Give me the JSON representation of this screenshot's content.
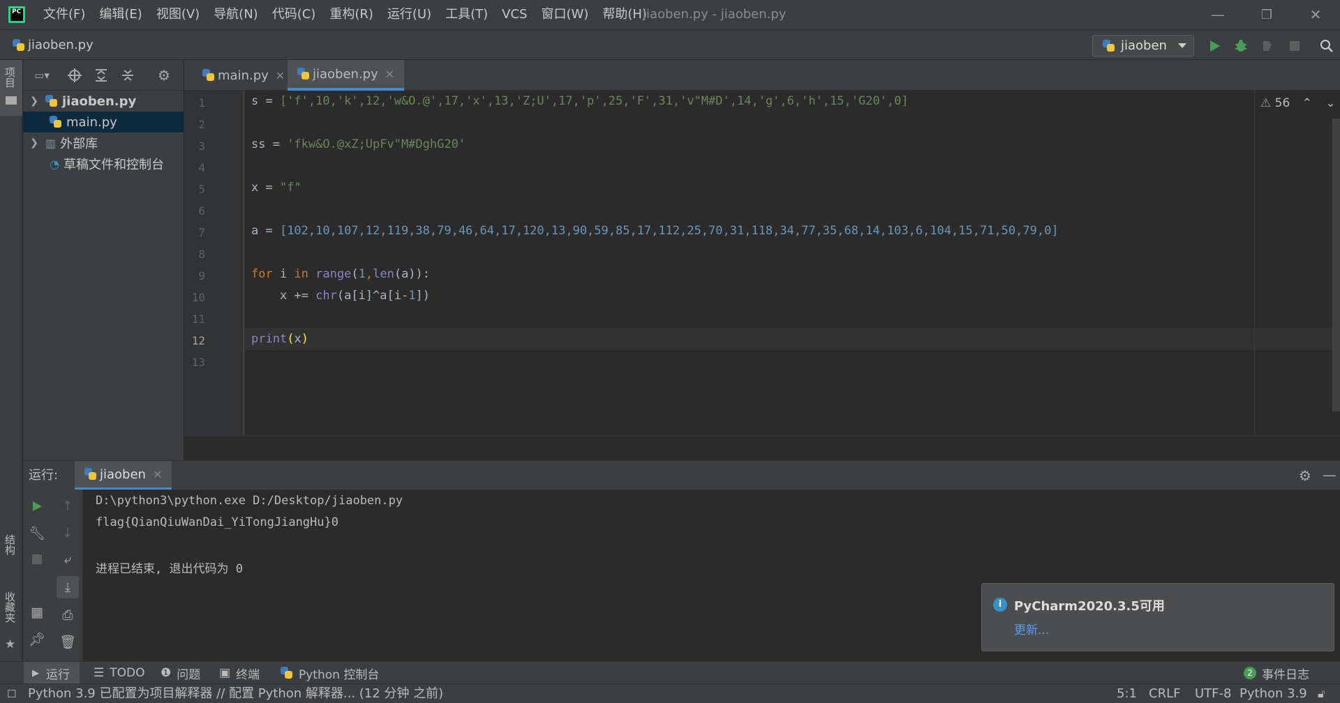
{
  "menu": {
    "items": [
      "文件(F)",
      "编辑(E)",
      "视图(V)",
      "导航(N)",
      "代码(C)",
      "重构(R)",
      "运行(U)",
      "工具(T)",
      "VCS",
      "窗口(W)",
      "帮助(H)"
    ],
    "window_title": "jiaoben.py - jiaoben.py"
  },
  "nav": {
    "crumb": "jiaoben.py",
    "run_config": "jiaoben"
  },
  "sidebar": {
    "project_label": "项目",
    "structure_label": "结构",
    "favorites_label": "收藏夹"
  },
  "project_tree": [
    {
      "label": "jiaoben.py",
      "bold": true
    },
    {
      "label": "main.py"
    },
    {
      "label": "外部库"
    },
    {
      "label": "草稿文件和控制台"
    }
  ],
  "editor": {
    "tabs": [
      "main.py",
      "jiaoben.py"
    ],
    "warnings": "56",
    "line_numbers": [
      "1",
      "2",
      "3",
      "4",
      "5",
      "6",
      "7",
      "8",
      "9",
      "10",
      "11",
      "12",
      "13"
    ],
    "lines": {
      "l1_s_list": "['f',10,'k',12,'w&O.@',17,'x',13,'Z;U',17,'p',25,'F',31,'v\"M#D',14,'g',6,'h',15,'G20',0]",
      "l3_ss_value": "'fkw&O.@xZ;UpFv\"M#DghG20'",
      "l5_x_value": "\"f\"",
      "l7_a_list": "[102,10,107,12,119,38,79,46,64,17,120,13,90,59,85,17,112,25,70,31,118,34,77,35,68,14,103,6,104,15,71,50,79,0]"
    }
  },
  "run": {
    "label": "运行:",
    "tab": "jiaoben",
    "output": [
      "D:\\python3\\python.exe D:/Desktop/jiaoben.py",
      "flag{QianQiuWanDai_YiTongJiangHu}0",
      "",
      "进程已结束, 退出代码为 0"
    ]
  },
  "notification": {
    "title": "PyCharm2020.3.5可用",
    "link": "更新..."
  },
  "tool_tabs": {
    "run": "运行",
    "todo": "TODO",
    "problems": "问题",
    "terminal": "终端",
    "python_console": "Python 控制台",
    "event_count": "2",
    "event_log": "事件日志"
  },
  "status": {
    "message": "Python 3.9 已配置为项目解释器 // 配置 Python 解释器... (12 分钟 之前)",
    "position": "5:1",
    "line_ending": "CRLF",
    "encoding": "UTF-8",
    "interpreter": "Python 3.9"
  },
  "colors": {
    "accent": "#4a88c7",
    "run_green": "#499c54",
    "string": "#6a8759",
    "number": "#6897bb",
    "keyword": "#cc7832"
  }
}
